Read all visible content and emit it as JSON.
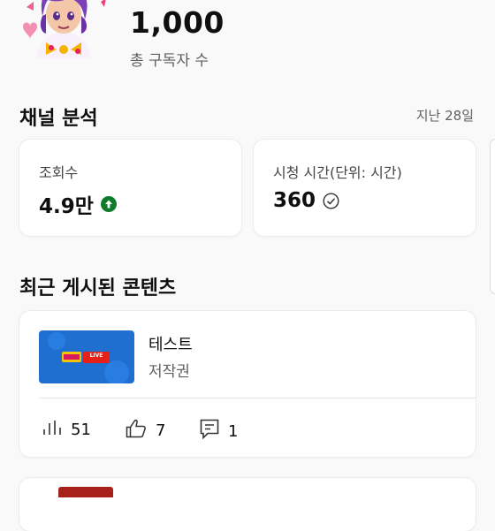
{
  "channel": {
    "subscriber_count": "1,000",
    "subscriber_label": "총 구독자 수"
  },
  "analytics": {
    "title": "채널 분석",
    "period": "지난 28일",
    "views": {
      "label": "조회수",
      "value": "4.9만",
      "icon": "arrow-up-circle-icon",
      "icon_color": "#0f7b2a"
    },
    "watch_time": {
      "label": "시청 시간(단위: 시간)",
      "value": "360",
      "icon": "check-circle-icon"
    }
  },
  "recent": {
    "title": "최근 게시된 콘텐츠",
    "videos": [
      {
        "title": "테스트",
        "subtitle": "저작권",
        "thumbnail_badge": "LIVE",
        "views": "51",
        "likes": "7",
        "comments": "1"
      }
    ]
  },
  "colors": {
    "background": "#f9f9f9",
    "card": "#ffffff",
    "thumbnail_blue": "#1f6fd1",
    "live_red": "#e62117"
  }
}
